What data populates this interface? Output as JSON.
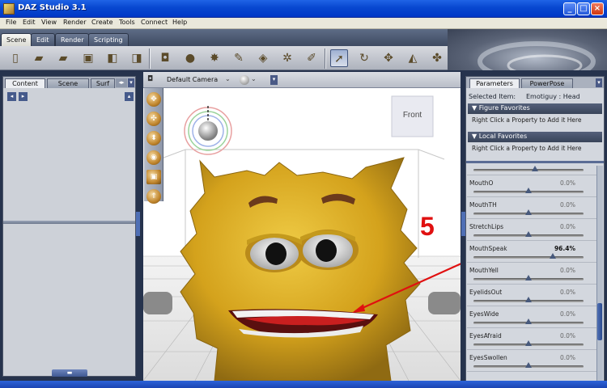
{
  "window": {
    "title": "DAZ Studio 3.1",
    "controls": [
      "minimize-icon",
      "maximize-icon",
      "close-icon"
    ]
  },
  "menu": [
    "File",
    "Edit",
    "View",
    "Render",
    "Create",
    "Tools",
    "Connect",
    "Help"
  ],
  "scene_tabs": [
    "Scene",
    "Edit",
    "Render",
    "Scripting"
  ],
  "toolbar": {
    "icons": [
      "new-scene-icon",
      "open-icon",
      "merge-icon",
      "save-icon",
      "import-icon",
      "export-icon",
      "camera-icon",
      "light-icon",
      "spotlight-icon",
      "pin-icon",
      "cube-icon",
      "joint-icon",
      "pointer-icon",
      "select-arrow-icon",
      "rotate-icon",
      "translate-icon",
      "scale-icon",
      "universal-icon"
    ]
  },
  "left_panel": {
    "tabs": [
      "Content",
      "Scene",
      "Surf"
    ]
  },
  "viewport": {
    "camera": "Default Camera",
    "view_label": "Front",
    "annotation": "5"
  },
  "right_panel": {
    "tabs": [
      "Parameters",
      "PowerPose"
    ],
    "selected_label": "Selected Item:",
    "selected_value": "Emotiguy : Head",
    "figure_favorites": "Figure Favorites",
    "local_favorites": "Local Favorites",
    "hint": "Right Click a Property to Add it Here",
    "parameters": [
      {
        "name": "MouthO",
        "value": "0.0%",
        "pct": 0
      },
      {
        "name": "MouthTH",
        "value": "0.0%",
        "pct": 0
      },
      {
        "name": "StretchLips",
        "value": "0.0%",
        "pct": 0
      },
      {
        "name": "MouthSpeak",
        "value": "96.4%",
        "pct": 96.4
      },
      {
        "name": "MouthYell",
        "value": "0.0%",
        "pct": 0
      },
      {
        "name": "EyelidsOut",
        "value": "0.0%",
        "pct": 0
      },
      {
        "name": "EyesWide",
        "value": "0.0%",
        "pct": 0
      },
      {
        "name": "EyesAfraid",
        "value": "0.0%",
        "pct": 0
      },
      {
        "name": "EyesSwollen",
        "value": "0.0%",
        "pct": 0
      }
    ]
  },
  "colors": {
    "accent": "#e01010",
    "title_blue": "#0847d0",
    "panel_head": "#394459",
    "face_yellow": "#d9aa20"
  }
}
